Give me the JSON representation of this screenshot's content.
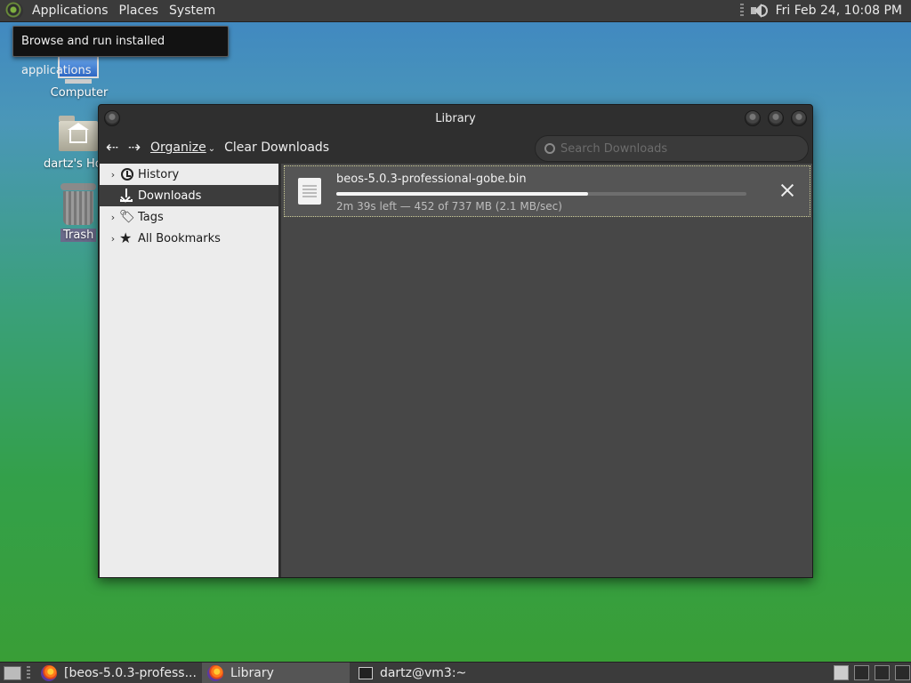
{
  "top_panel": {
    "menus": [
      "Applications",
      "Places",
      "System"
    ],
    "clock": "Fri Feb 24, 10:08 PM"
  },
  "tooltip": "Browse and run installed applications",
  "desktop_icons": {
    "computer": "Computer",
    "home": "dartz's Ho",
    "trash": "Trash"
  },
  "window": {
    "title": "Library",
    "toolbar": {
      "organize": "Organize",
      "clear_downloads": "Clear Downloads",
      "search_placeholder": "Search Downloads"
    },
    "sidebar": {
      "items": [
        "History",
        "Downloads",
        "Tags",
        "All Bookmarks"
      ],
      "selected": "Downloads"
    },
    "download": {
      "filename": "beos-5.0.3-professional-gobe.bin",
      "status": "2m 39s left — 452 of 737 MB (2.1 MB/sec)",
      "progress_fraction": 0.613
    }
  },
  "taskbar": {
    "tasks": [
      "[beos-5.0.3-profess...",
      "Library",
      "dartz@vm3:~"
    ],
    "active_task": "Library"
  }
}
